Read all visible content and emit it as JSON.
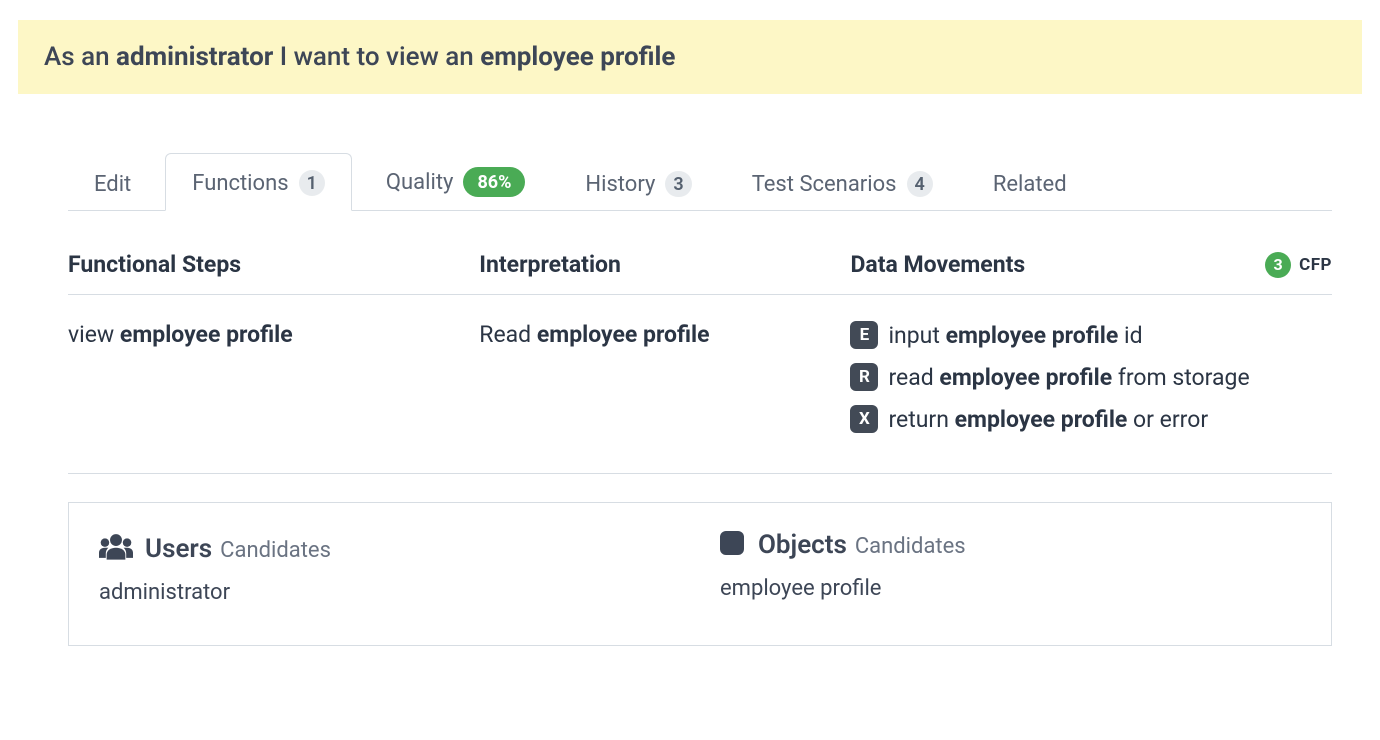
{
  "story": {
    "prefix": "As an ",
    "role": "administrator",
    "middle": " I want to view an ",
    "target": "employee profile"
  },
  "tabs": {
    "edit": "Edit",
    "functions": {
      "label": "Functions",
      "count": "1"
    },
    "quality": {
      "label": "Quality",
      "pct": "86%"
    },
    "history": {
      "label": "History",
      "count": "3"
    },
    "test_scenarios": {
      "label": "Test Scenarios",
      "count": "4"
    },
    "related": "Related"
  },
  "columns": {
    "functional_steps": "Functional Steps",
    "interpretation": "Interpretation",
    "data_movements": "Data Movements",
    "cfp_count": "3",
    "cfp_label": "CFP"
  },
  "row": {
    "step_prefix": "view ",
    "step_bold": "employee profile",
    "interp_prefix": "Read ",
    "interp_bold": "employee profile",
    "dm": [
      {
        "code": "E",
        "pre": "input ",
        "bold": "employee profile",
        "post": " id"
      },
      {
        "code": "R",
        "pre": "read ",
        "bold": "employee profile",
        "post": " from storage"
      },
      {
        "code": "X",
        "pre": "return ",
        "bold": "employee profile",
        "post": " or error"
      }
    ]
  },
  "candidates": {
    "users_title": "Users",
    "users_sub": "Candidates",
    "users_item": "administrator",
    "objects_title": "Objects",
    "objects_sub": "Candidates",
    "objects_item": "employee profile"
  }
}
